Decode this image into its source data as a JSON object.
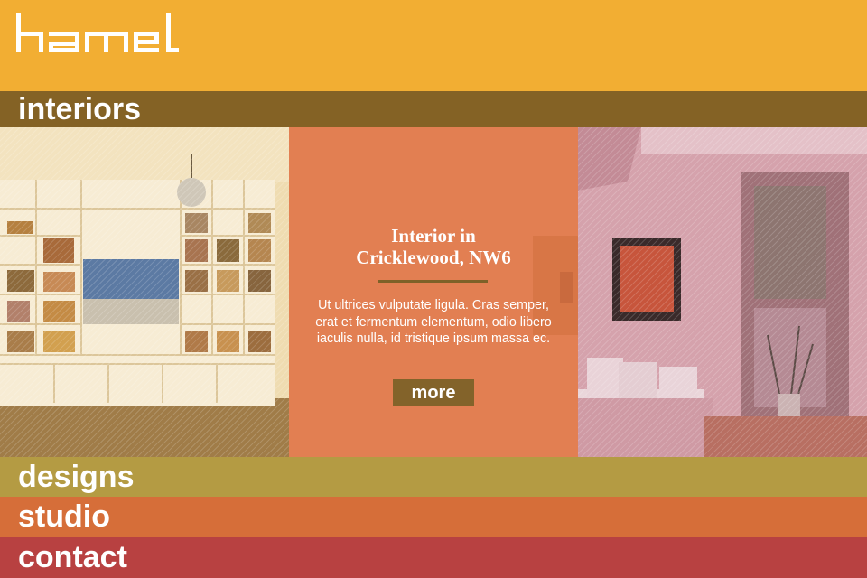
{
  "header": {
    "logo_text": "hamel",
    "logo_icon": "hamel-wordmark-logo",
    "background": "#f2ae33"
  },
  "nav": {
    "interiors": "interiors",
    "designs": "designs",
    "studio": "studio",
    "contact": "contact"
  },
  "feature": {
    "title_line1": "Interior in",
    "title_line2": "Cricklewood, NW6",
    "body": "Ut ultrices vulputate ligula. Cras semper, erat et fermentum elementum, odio libero iaculis nulla, id tristique ipsum massa ec.",
    "more_label": "more"
  },
  "colors": {
    "header": "#f2ae33",
    "interiors": "#846225",
    "designs": "#b49b43",
    "studio": "#d66e39",
    "contact": "#b84141",
    "feature_panel": "#e28054"
  }
}
